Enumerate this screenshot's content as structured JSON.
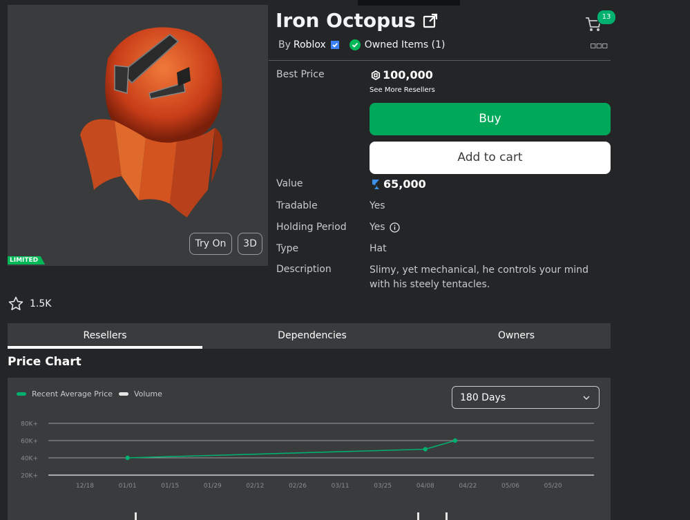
{
  "item": {
    "title": "Iron Octopus",
    "by_label": "By",
    "creator": "Roblox",
    "owned_label": "Owned Items (1)",
    "limited_tag": "LIMITED",
    "try_on": "Try On",
    "view_3d": "3D",
    "favorites": "1.5K"
  },
  "header": {
    "cart_count": "13"
  },
  "details": {
    "best_price_label": "Best Price",
    "best_price": "100,000",
    "see_resellers": "See More Resellers",
    "buy_label": "Buy",
    "add_to_cart_label": "Add to cart",
    "value_label": "Value",
    "value": "65,000",
    "tradable_label": "Tradable",
    "tradable": "Yes",
    "holding_label": "Holding Period",
    "holding": "Yes",
    "type_label": "Type",
    "type": "Hat",
    "description_label": "Description",
    "description": "Slimy, yet mechanical, he controls your mind with his steely tentacles."
  },
  "tabs": [
    "Resellers",
    "Dependencies",
    "Owners"
  ],
  "price_chart": {
    "heading": "Price Chart",
    "range_select": "180 Days",
    "colors": {
      "avg": "#00b06f",
      "volume": "#e6e6e6"
    }
  },
  "chart_data": {
    "type": "line",
    "categories": [
      "12/18",
      "01/01",
      "01/15",
      "01/29",
      "02/12",
      "02/26",
      "03/11",
      "03/25",
      "04/08",
      "04/22",
      "05/06",
      "05/20"
    ],
    "y_ticks": [
      "20K+",
      "40K+",
      "60K+",
      "80K+"
    ],
    "ylim": [
      20000,
      80000
    ],
    "series": [
      {
        "name": "Recent Average Price",
        "points": [
          [
            1,
            40000
          ],
          [
            8,
            50000
          ],
          [
            8.7,
            60000
          ]
        ]
      },
      {
        "name": "Volume",
        "values": []
      }
    ],
    "grid": true,
    "legend": "top-left"
  }
}
